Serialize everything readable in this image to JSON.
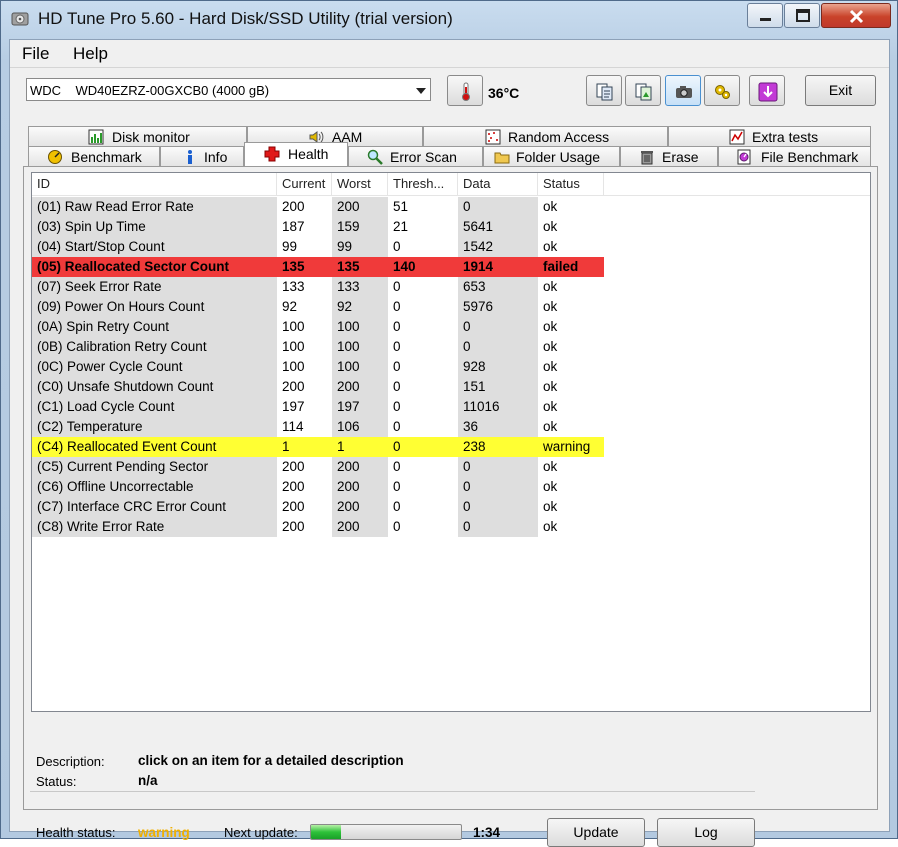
{
  "window": {
    "title": "HD Tune Pro 5.60 - Hard Disk/SSD Utility (trial version)"
  },
  "menu": [
    {
      "label": "File"
    },
    {
      "label": "Help"
    }
  ],
  "toolbar": {
    "drive": "WDC    WD40EZRZ-00GXCB0 (4000 gB)",
    "temperature": "36°C",
    "exit_label": "Exit"
  },
  "tabs_row1": [
    {
      "label": "Disk monitor",
      "icon": "disk-monitor-icon"
    },
    {
      "label": "AAM",
      "icon": "speaker-icon"
    },
    {
      "label": "Random Access",
      "icon": "random-access-icon"
    },
    {
      "label": "Extra tests",
      "icon": "extra-tests-icon"
    }
  ],
  "tabs_row2": [
    {
      "label": "Benchmark",
      "icon": "benchmark-icon"
    },
    {
      "label": "Info",
      "icon": "info-icon"
    },
    {
      "label": "Health",
      "icon": "health-cross-icon",
      "active": true
    },
    {
      "label": "Error Scan",
      "icon": "magnifier-icon"
    },
    {
      "label": "Folder Usage",
      "icon": "folder-icon"
    },
    {
      "label": "Erase",
      "icon": "trash-icon"
    },
    {
      "label": "File Benchmark",
      "icon": "file-benchmark-icon"
    }
  ],
  "table": {
    "columns": [
      "ID",
      "Current",
      "Worst",
      "Thresh...",
      "Data",
      "Status"
    ],
    "rows": [
      {
        "id": "(01) Raw Read Error Rate",
        "current": "200",
        "worst": "200",
        "thresh": "51",
        "data": "0",
        "status": "ok"
      },
      {
        "id": "(03) Spin Up Time",
        "current": "187",
        "worst": "159",
        "thresh": "21",
        "data": "5641",
        "status": "ok"
      },
      {
        "id": "(04) Start/Stop Count",
        "current": "99",
        "worst": "99",
        "thresh": "0",
        "data": "1542",
        "status": "ok"
      },
      {
        "id": "(05) Reallocated Sector Count",
        "current": "135",
        "worst": "135",
        "thresh": "140",
        "data": "1914",
        "status": "failed"
      },
      {
        "id": "(07) Seek Error Rate",
        "current": "133",
        "worst": "133",
        "thresh": "0",
        "data": "653",
        "status": "ok"
      },
      {
        "id": "(09) Power On Hours Count",
        "current": "92",
        "worst": "92",
        "thresh": "0",
        "data": "5976",
        "status": "ok"
      },
      {
        "id": "(0A) Spin Retry Count",
        "current": "100",
        "worst": "100",
        "thresh": "0",
        "data": "0",
        "status": "ok"
      },
      {
        "id": "(0B) Calibration Retry Count",
        "current": "100",
        "worst": "100",
        "thresh": "0",
        "data": "0",
        "status": "ok"
      },
      {
        "id": "(0C) Power Cycle Count",
        "current": "100",
        "worst": "100",
        "thresh": "0",
        "data": "928",
        "status": "ok"
      },
      {
        "id": "(C0) Unsafe Shutdown Count",
        "current": "200",
        "worst": "200",
        "thresh": "0",
        "data": "151",
        "status": "ok"
      },
      {
        "id": "(C1) Load Cycle Count",
        "current": "197",
        "worst": "197",
        "thresh": "0",
        "data": "11016",
        "status": "ok"
      },
      {
        "id": "(C2) Temperature",
        "current": "114",
        "worst": "106",
        "thresh": "0",
        "data": "36",
        "status": "ok"
      },
      {
        "id": "(C4) Reallocated Event Count",
        "current": "1",
        "worst": "1",
        "thresh": "0",
        "data": "238",
        "status": "warning"
      },
      {
        "id": "(C5) Current Pending Sector",
        "current": "200",
        "worst": "200",
        "thresh": "0",
        "data": "0",
        "status": "ok"
      },
      {
        "id": "(C6) Offline Uncorrectable",
        "current": "200",
        "worst": "200",
        "thresh": "0",
        "data": "0",
        "status": "ok"
      },
      {
        "id": "(C7) Interface CRC Error Count",
        "current": "200",
        "worst": "200",
        "thresh": "0",
        "data": "0",
        "status": "ok"
      },
      {
        "id": "(C8) Write Error Rate",
        "current": "200",
        "worst": "200",
        "thresh": "0",
        "data": "0",
        "status": "ok"
      }
    ]
  },
  "description": {
    "label": "Description:",
    "value": "click on an item for a detailed description"
  },
  "status": {
    "label": "Status:",
    "value": "n/a"
  },
  "health": {
    "label": "Health status:",
    "value": "warning",
    "color": "#f0b000"
  },
  "next_update": {
    "label": "Next update:",
    "progress_fraction": 0.2,
    "time": "1:34"
  },
  "buttons": {
    "update": "Update",
    "log": "Log"
  },
  "colors": {
    "failed_row": "#f03a3a",
    "warning_row": "#ffff33",
    "progress_green": "#2ec23a"
  }
}
